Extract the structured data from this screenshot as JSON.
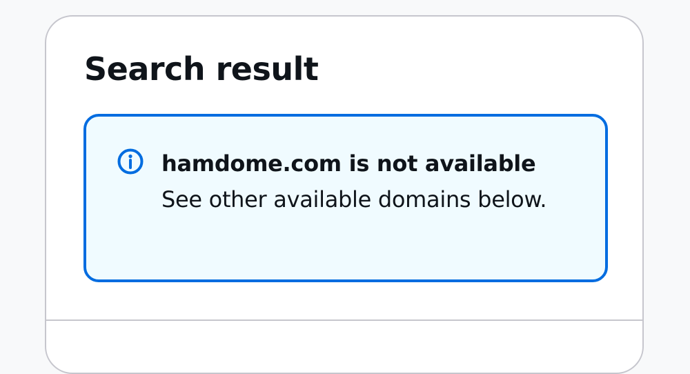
{
  "search": {
    "title": "Search result",
    "alert": {
      "icon": "info-icon",
      "header": "hamdome.com is not available",
      "message": "See other available domains below."
    }
  },
  "colors": {
    "info_accent": "#006ce0",
    "info_background": "#f0fbff",
    "text": "#0f141a",
    "border": "#c6c6cd"
  }
}
